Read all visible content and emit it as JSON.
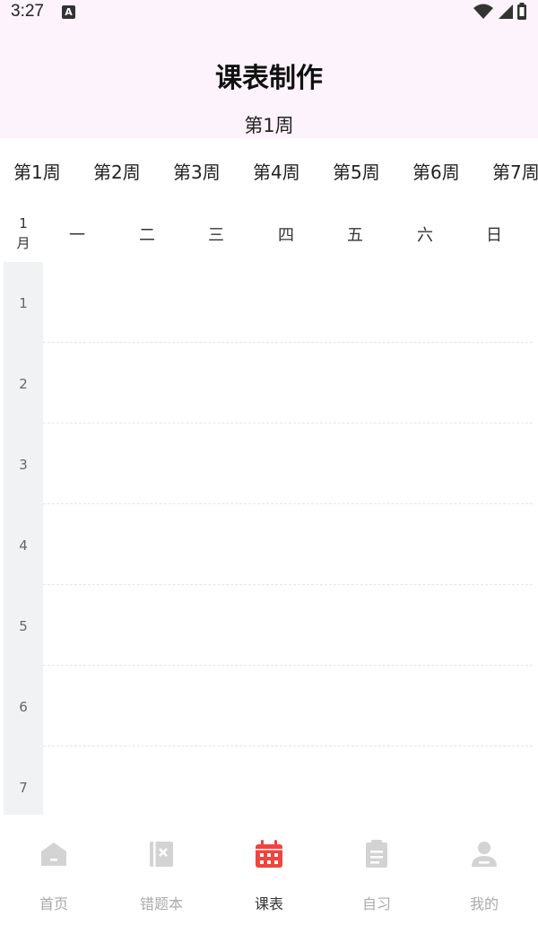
{
  "status_bar": {
    "time": "3:27",
    "notification_icon": "A",
    "icons": [
      "wifi-icon",
      "signal-icon",
      "battery-icon"
    ]
  },
  "header": {
    "title": "课表制作",
    "current_week": "第1周"
  },
  "week_tabs": [
    "第1周",
    "第2周",
    "第3周",
    "第4周",
    "第5周",
    "第6周",
    "第7周"
  ],
  "month": {
    "number": "1",
    "unit": "月"
  },
  "days": [
    "一",
    "二",
    "三",
    "四",
    "五",
    "六",
    "日"
  ],
  "periods": [
    "1",
    "2",
    "3",
    "4",
    "5",
    "6",
    "7"
  ],
  "bottom_nav": {
    "items": [
      {
        "label": "首页",
        "icon": "home-icon"
      },
      {
        "label": "错题本",
        "icon": "notebook-icon"
      },
      {
        "label": "课表",
        "icon": "calendar-icon"
      },
      {
        "label": "自习",
        "icon": "clipboard-icon"
      },
      {
        "label": "我的",
        "icon": "user-icon"
      }
    ],
    "active_index": 2
  },
  "colors": {
    "header_bg": "#fcf3fc",
    "accent": "#f0443e",
    "inactive_icon": "#d3d3d3",
    "period_col_bg": "#f1f2f4"
  }
}
